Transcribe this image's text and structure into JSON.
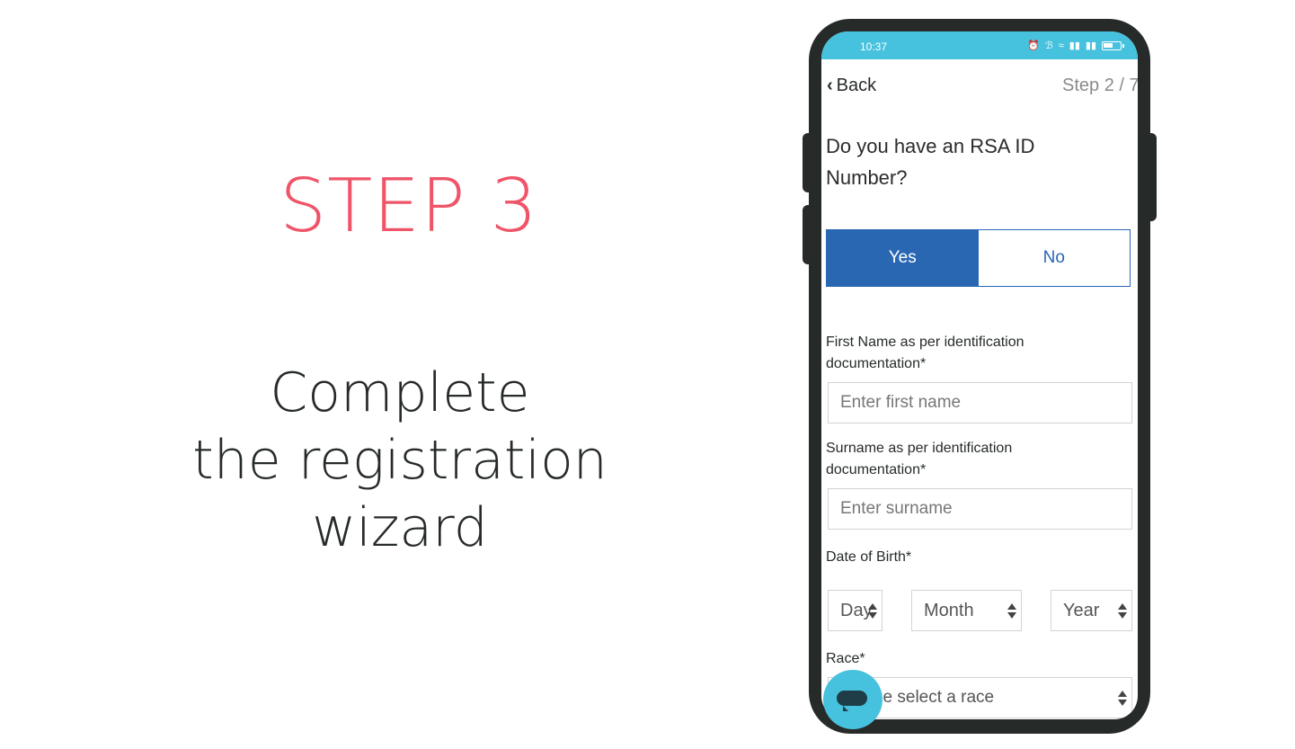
{
  "promo": {
    "step_title": "STEP 3",
    "lines": [
      "Complete",
      "the registration",
      "wizard"
    ],
    "accent_color": "#ef5468"
  },
  "phone": {
    "status_bar": {
      "time": "10:37",
      "icons": [
        "alarm-icon",
        "bluetooth-icon",
        "wifi-icon",
        "signal-5g-icon",
        "signal-4g-icon",
        "battery-icon"
      ],
      "color": "#47c2de"
    },
    "nav": {
      "back_label": "Back",
      "step_indicator": "Step 2 / 7"
    },
    "question": "Do you have an RSA ID Number?",
    "toggle": {
      "yes_label": "Yes",
      "no_label": "No",
      "selected": "Yes",
      "color": "#2a67b3"
    },
    "form": {
      "first_name_label": "First Name as per identification documentation*",
      "first_name_placeholder": "Enter first name",
      "surname_label": "Surname as per identification documentation*",
      "surname_placeholder": "Enter surname",
      "dob_label": "Date of Birth*",
      "day_value": "Day",
      "month_value": "Month",
      "year_value": "Year",
      "race_label": "Race*",
      "race_value": "Please select a race"
    },
    "chat": {
      "icon": "chat-icon"
    }
  }
}
